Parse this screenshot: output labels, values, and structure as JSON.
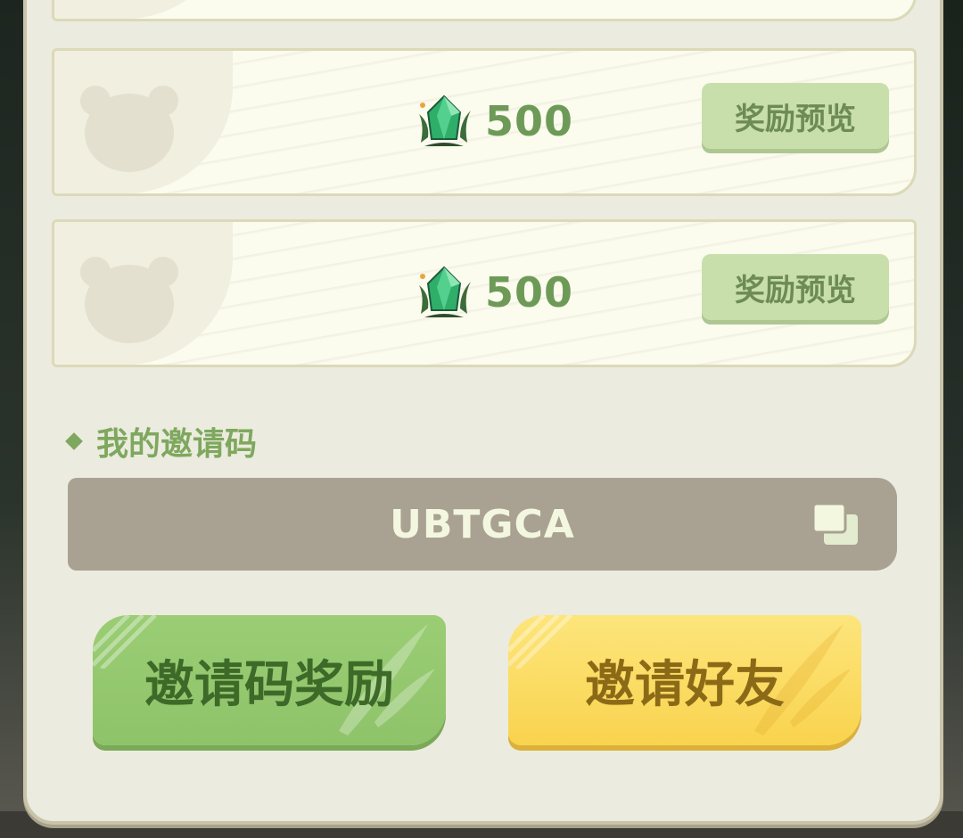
{
  "reward_cards": [
    {
      "amount": "500",
      "preview_label": "奖励预览"
    },
    {
      "amount": "500",
      "preview_label": "奖励预览"
    }
  ],
  "invite": {
    "section_label": "我的邀请码",
    "code": "UBTGCA"
  },
  "actions": {
    "code_reward_label": "邀请码奖励",
    "invite_friends_label": "邀请好友"
  },
  "colors": {
    "panel_bg": "#ecebdf",
    "green_button": "#8fc36a",
    "yellow_button": "#f9d34e",
    "code_box": "#a9a192",
    "accent_green": "#7ea85e"
  },
  "icons": {
    "reward_icon": "green-gem-icon",
    "avatar_placeholder": "bear-silhouette-icon",
    "copy": "copy-icon"
  }
}
